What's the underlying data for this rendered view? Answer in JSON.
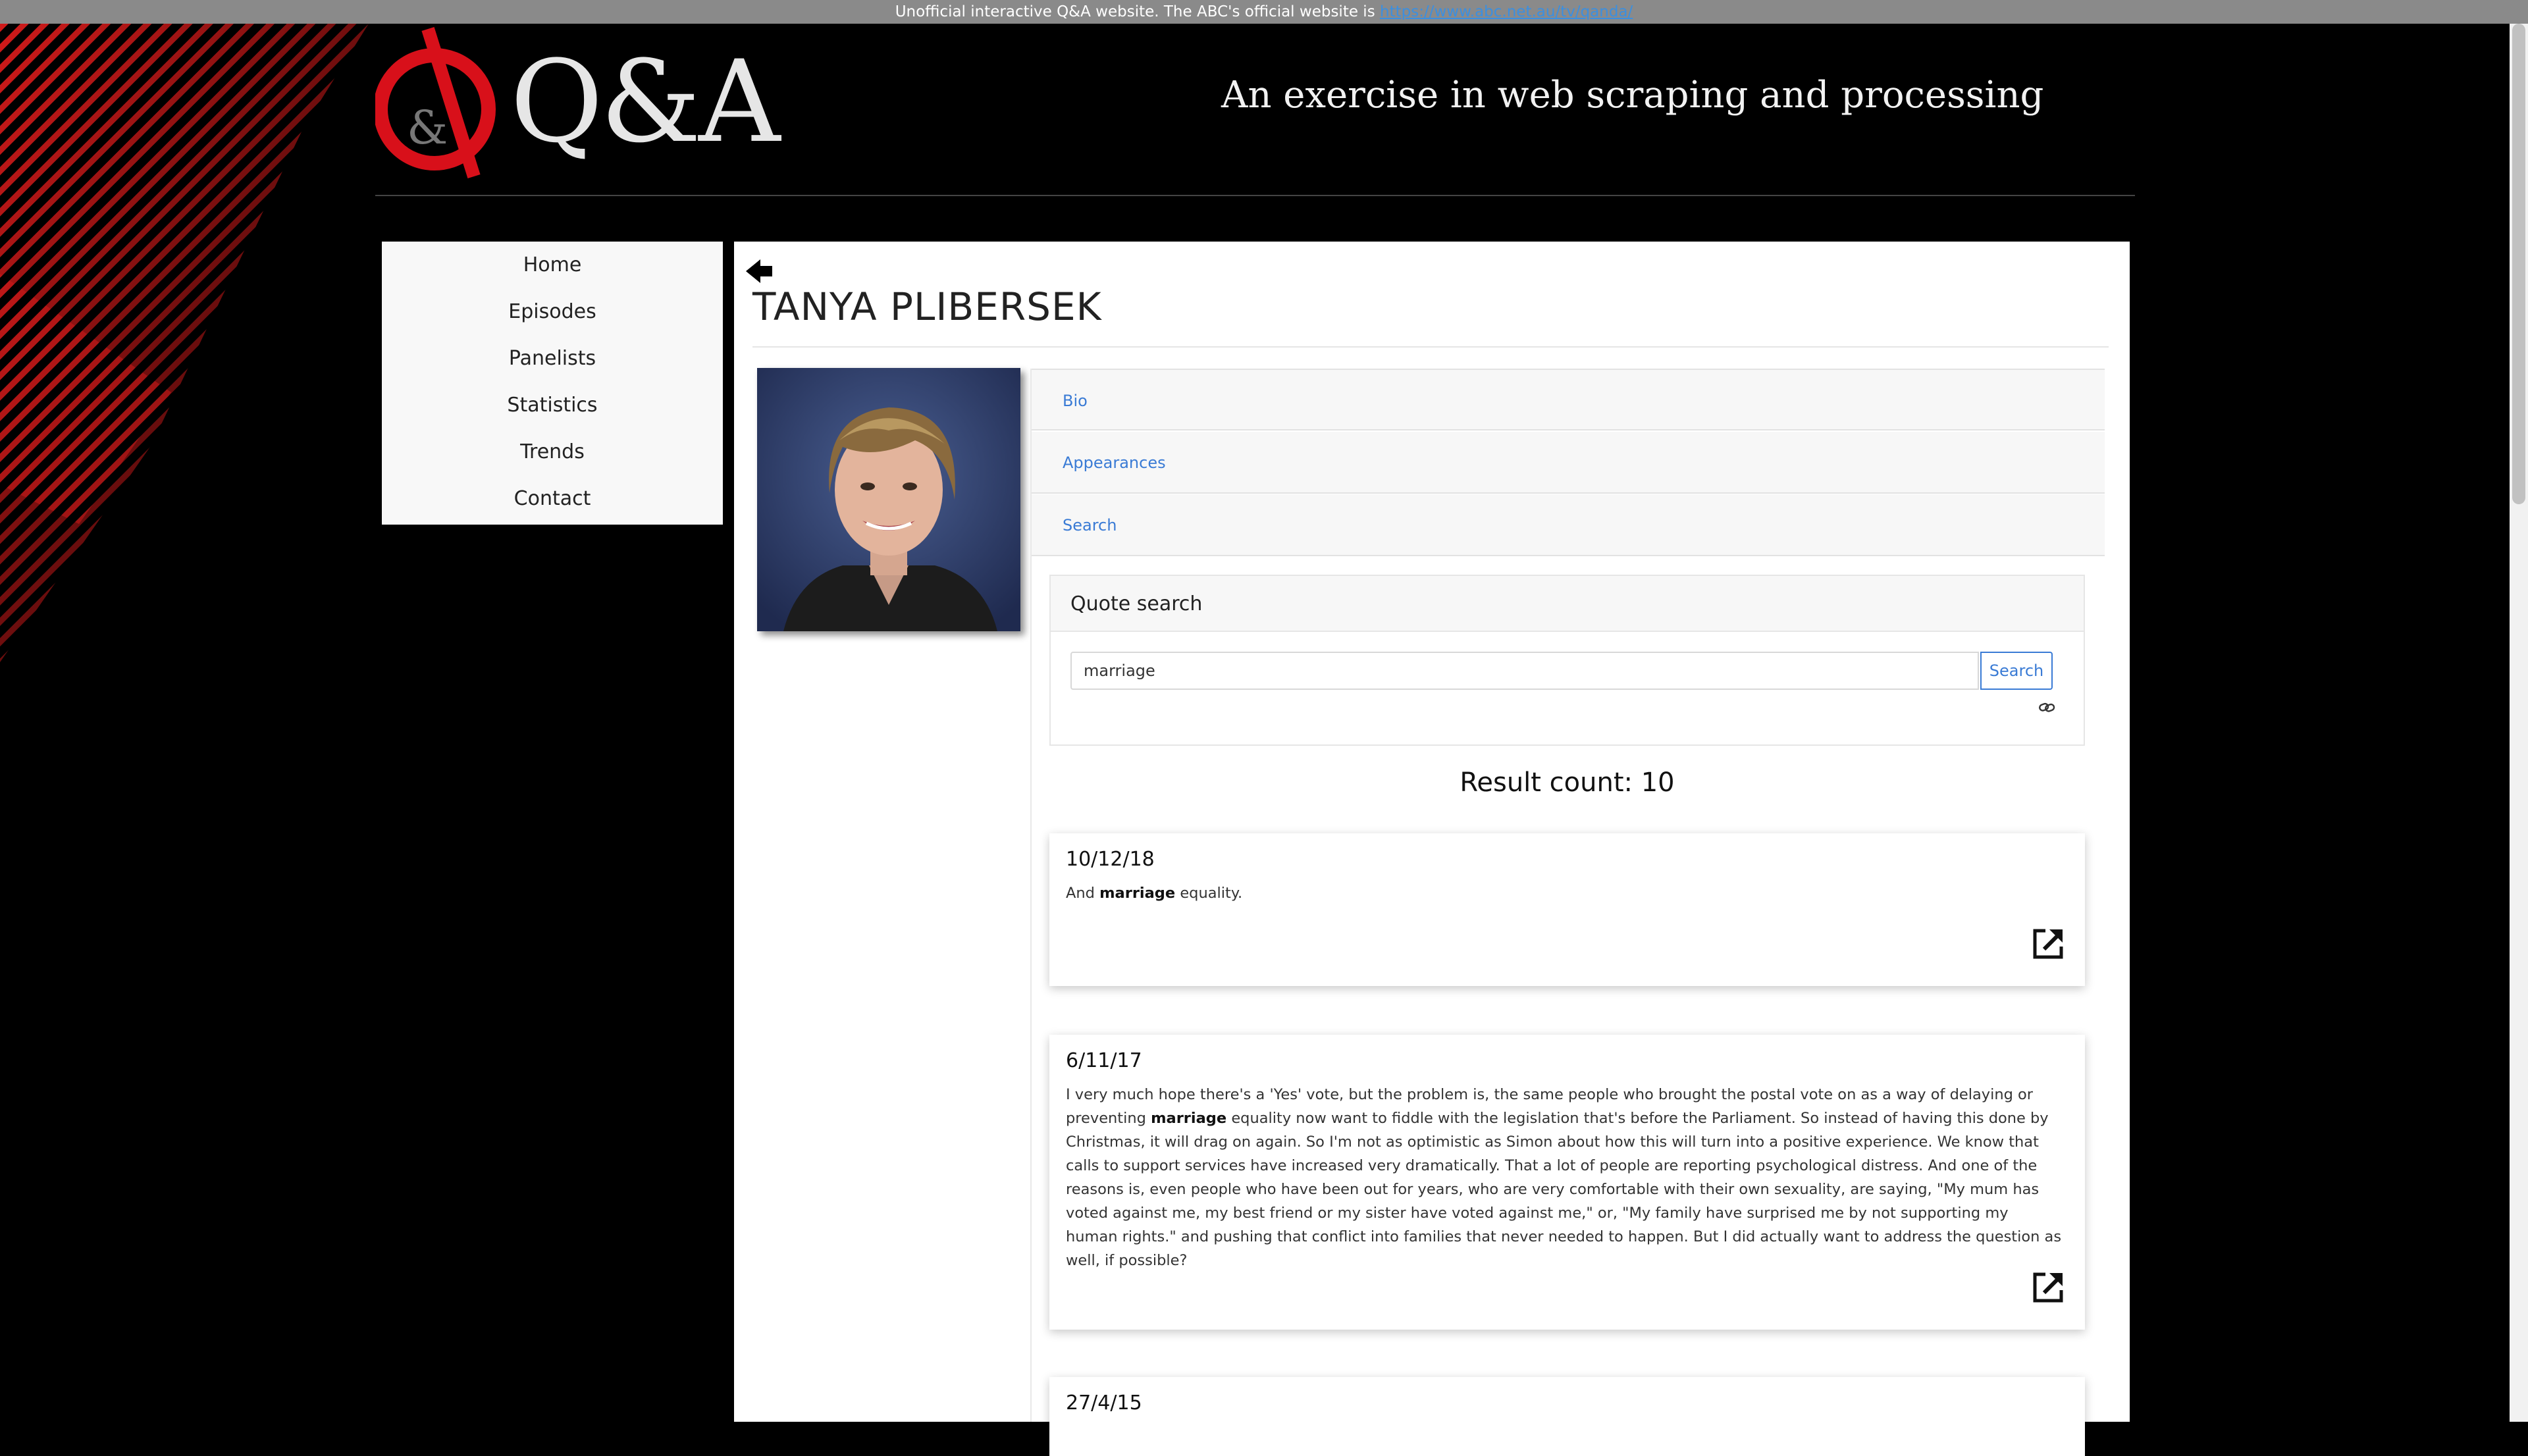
{
  "notice": {
    "text": "Unofficial interactive Q&A website. The ABC's official website is",
    "link": "https://www.abc.net.au/tv/qanda/"
  },
  "header": {
    "logo_text": "Q&A",
    "logo_mark": "&",
    "tagline": "An exercise in web scraping and processing"
  },
  "nav": {
    "items": [
      "Home",
      "Episodes",
      "Panelists",
      "Statistics",
      "Trends",
      "Contact"
    ]
  },
  "panelist": {
    "name": "TANYA PLIBERSEK"
  },
  "accordion": {
    "bio": "Bio",
    "appearances": "Appearances",
    "search": "Search"
  },
  "quote_search": {
    "title": "Quote search",
    "query": "marriage",
    "button": "Search"
  },
  "results": {
    "count_label": "Result count: 10",
    "items": [
      {
        "date": "10/12/18",
        "before": "And ",
        "match": "marriage",
        "after": " equality."
      },
      {
        "date": "6/11/17",
        "before": "I very much hope there's a 'Yes' vote, but the problem is, the same people who brought the postal vote on as a way of delaying or preventing ",
        "match": "marriage",
        "after": " equality now want to fiddle with the legislation that's before the Parliament. So instead of having this done by Christmas, it will drag on again. So I'm not as optimistic as Simon about how this will turn into a positive experience. We know that calls to support services have increased very dramatically. That a lot of people are reporting psychological distress. And one of the reasons is, even people who have been out for years, who are very comfortable with their own sexuality, are saying, \"My mum has voted against me, my best friend or my sister have voted against me,\" or, \"My family have surprised me by not supporting my human rights.\" and pushing that conflict into families that never needed to happen. But I did actually want to address the question as well, if possible?"
      },
      {
        "date": "27/4/15"
      }
    ]
  },
  "icons": {
    "back": "arrow-left-icon",
    "external": "external-link-icon",
    "link": "chain-link-icon"
  },
  "colors": {
    "accent": "#3a7bd5",
    "brand_red": "#e0101a",
    "background": "#000000"
  }
}
